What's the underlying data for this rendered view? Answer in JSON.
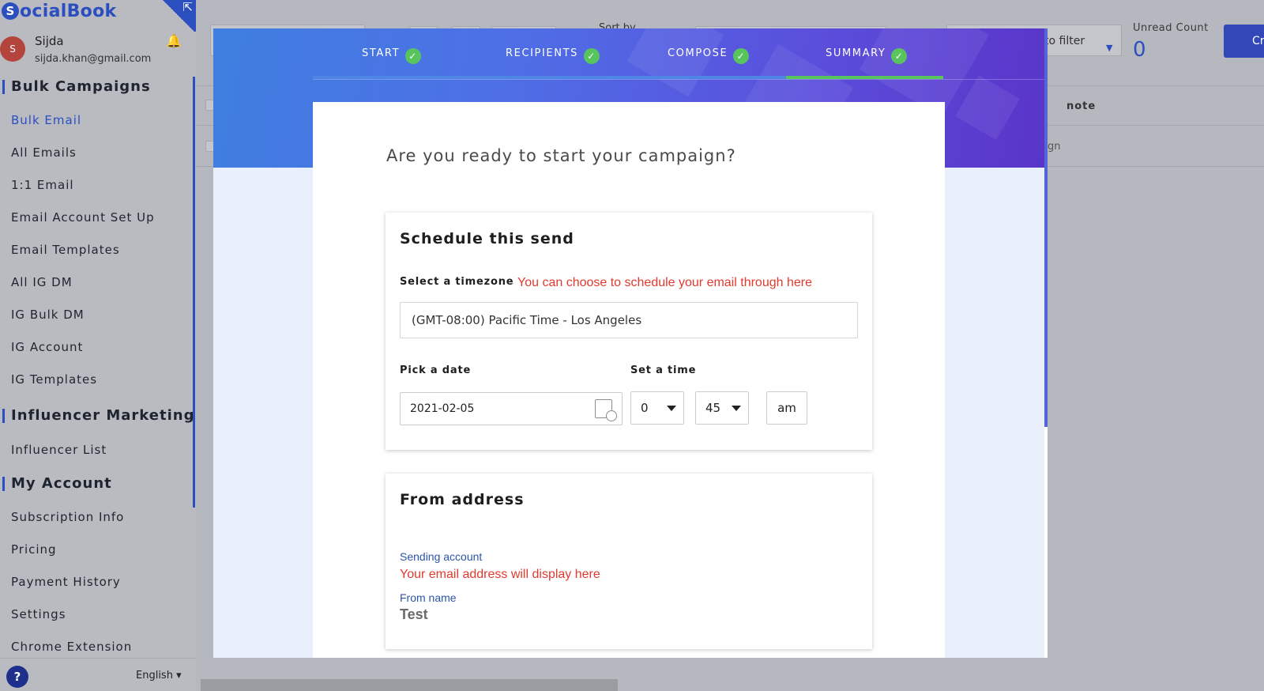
{
  "brand": {
    "name": "ocialBook",
    "mark": "S"
  },
  "user": {
    "initial": "S",
    "name": "Sijda",
    "email": "sijda.khan@gmail.com"
  },
  "sidebar": {
    "sections": [
      {
        "title": "Bulk Campaigns",
        "items": [
          "Bulk Email",
          "All Emails",
          "1:1 Email",
          "Email Account Set Up",
          "Email Templates",
          "All IG DM",
          "IG Bulk DM",
          "IG Account",
          "IG Templates"
        ]
      },
      {
        "title": "Influencer Marketing",
        "items": [
          "Influencer List"
        ]
      },
      {
        "title": "My Account",
        "items": [
          "Subscription Info",
          "Pricing",
          "Payment History",
          "Settings",
          "Chrome Extension"
        ]
      }
    ],
    "active_item": "Bulk Email",
    "help_label": "?",
    "language": "English ▾"
  },
  "background_page": {
    "sort_label": "Sort by",
    "filter_label": "to filter",
    "unread_label": "Unread Count",
    "unread_value": "0",
    "create_button": "Cr",
    "column_note": "note",
    "cell_partial": "gn"
  },
  "wizard": {
    "steps": [
      {
        "label": "START",
        "done": true
      },
      {
        "label": "RECIPIENTS",
        "done": true
      },
      {
        "label": "COMPOSE",
        "done": true
      },
      {
        "label": "SUMMARY",
        "done": true
      }
    ],
    "active_step": "SUMMARY",
    "check_glyph": "✓",
    "question": "Are you ready to start your campaign?",
    "schedule": {
      "title": "Schedule this send",
      "timezone_label": "Select a timezone",
      "timezone_hint": "You can choose to schedule your email through here",
      "timezone_value": "(GMT-08:00) Pacific Time - Los Angeles",
      "date_label": "Pick a date",
      "date_value": "2021-02-05",
      "time_label": "Set a time",
      "hour_value": "0",
      "minute_value": "45",
      "ampm_value": "am"
    },
    "from": {
      "title": "From address",
      "sending_account_label": "Sending account",
      "sending_account_hint": "Your email address will display here",
      "from_name_label": "From name",
      "from_name_value": "Test"
    }
  },
  "colors": {
    "accent": "#2b4fbf",
    "step_done": "#58c45d",
    "hint_red": "#e23a2f",
    "label_blue": "#2b54a8"
  }
}
